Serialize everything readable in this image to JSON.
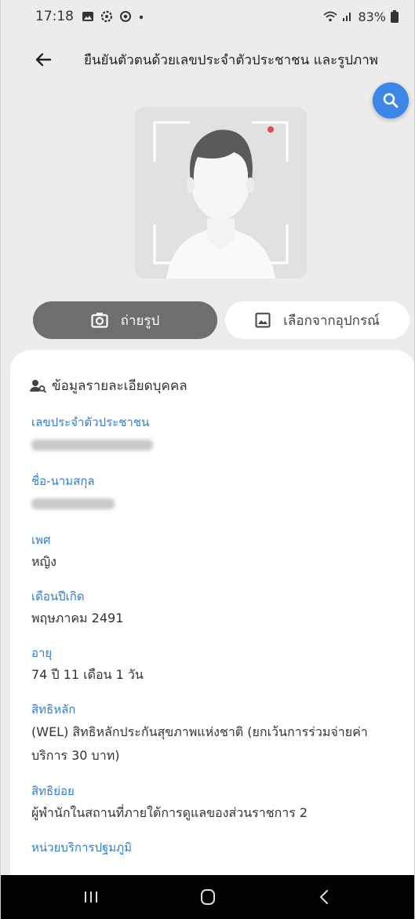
{
  "status": {
    "time": "17:18",
    "battery": "83%"
  },
  "header": {
    "title": "ยืนยันตัวตนด้วยเลขประจำตัวประชาชน และรูปภาพ"
  },
  "actions": {
    "camera_label": "ถ่ายรูป",
    "gallery_label": "เลือกจากอุปกรณ์"
  },
  "card": {
    "heading": "ข้อมูลรายละเอียดบุคคล",
    "fields": [
      {
        "label": "เลขประจำตัวประชาชน",
        "value": ""
      },
      {
        "label": "ชื่อ-นามสกุล",
        "value": ""
      },
      {
        "label": "เพศ",
        "value": "หญิง"
      },
      {
        "label": "เดือนปีเกิด",
        "value": "พฤษภาคม 2491"
      },
      {
        "label": "อายุ",
        "value": "74 ปี 11 เดือน 1 วัน"
      },
      {
        "label": "สิทธิหลัก",
        "value": "(WEL) สิทธิหลักประกันสุขภาพแห่งชาติ (ยกเว้นการร่วมจ่ายค่าบริการ 30 บาท)"
      },
      {
        "label": "สิทธิย่อย",
        "value": "ผู้พำนักในสถานที่ภายใต้การดูแลของส่วนราชการ 2"
      },
      {
        "label": "หน่วยบริการปฐมภูมิ",
        "value": ""
      }
    ]
  },
  "colors": {
    "accent": "#2d7fd3",
    "fab": "#3b86e6",
    "camera_button": "#6e6e6e"
  },
  "icons": [
    "back-arrow-icon",
    "search-icon",
    "camera-icon",
    "image-icon",
    "person-search-icon",
    "recent-apps-icon",
    "home-icon",
    "nav-back-icon"
  ]
}
